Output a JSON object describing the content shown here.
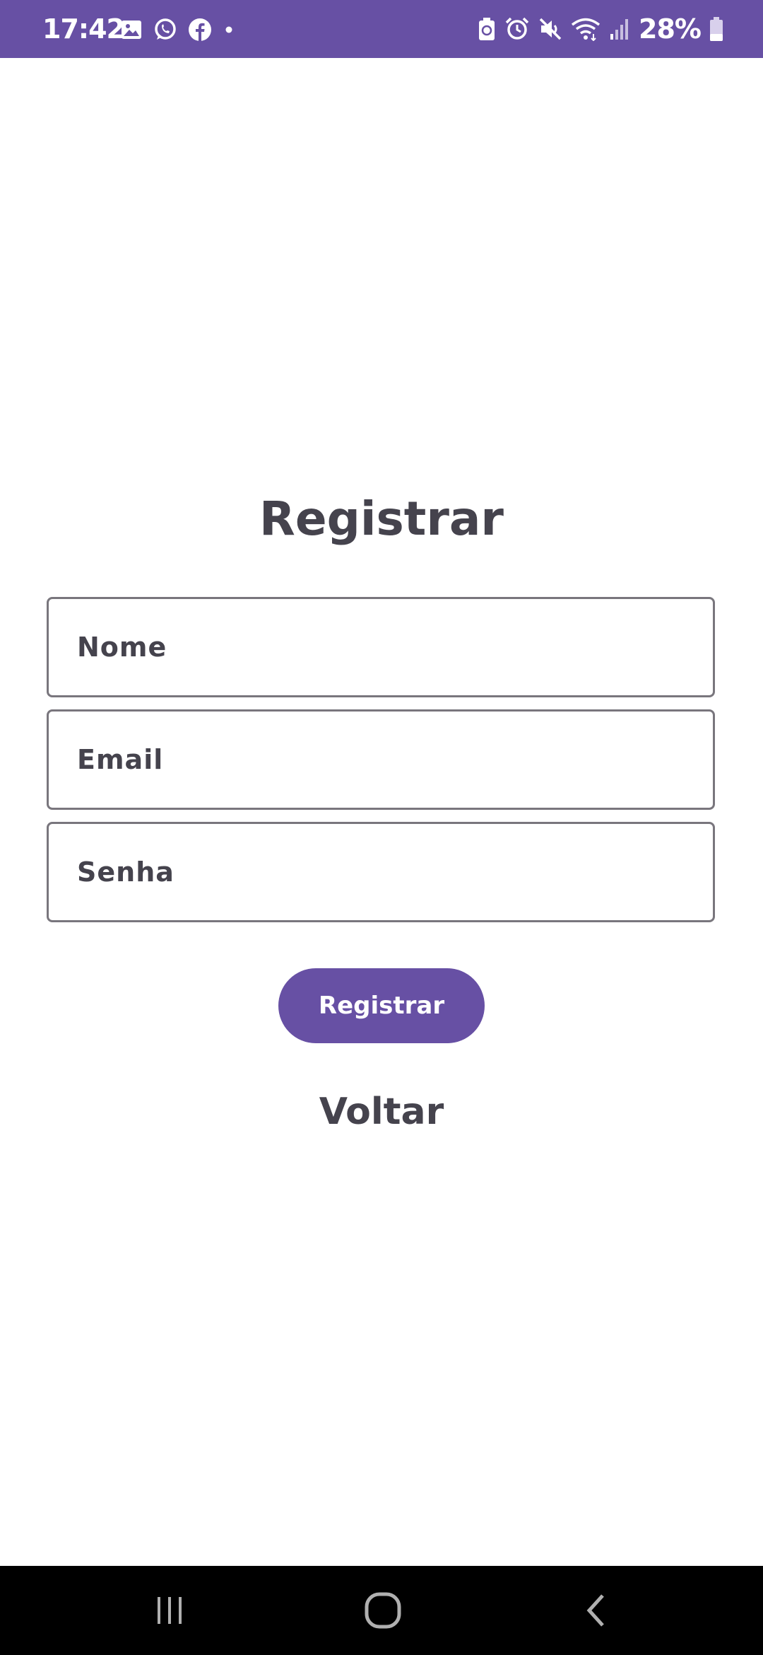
{
  "status_bar": {
    "time": "17:42",
    "battery_percent": "28%",
    "background_color": "#6750a4",
    "left_icons": [
      "gallery-icon",
      "whatsapp-icon",
      "facebook-icon",
      "dot-icon"
    ],
    "right_icons": [
      "battery-saver-icon",
      "alarm-icon",
      "mute-icon",
      "wifi-icon",
      "signal-icon",
      "battery-icon"
    ]
  },
  "form": {
    "title": "Registrar",
    "fields": {
      "name": {
        "placeholder": "Nome",
        "value": ""
      },
      "email": {
        "placeholder": "Email",
        "value": ""
      },
      "password": {
        "placeholder": "Senha",
        "value": ""
      }
    },
    "submit_label": "Registrar",
    "back_label": "Voltar"
  },
  "colors": {
    "accent": "#6750a4",
    "text": "#45434d",
    "field_border": "#79767d"
  },
  "nav_bar": {
    "buttons": [
      "recents-icon",
      "home-icon",
      "back-icon"
    ]
  }
}
